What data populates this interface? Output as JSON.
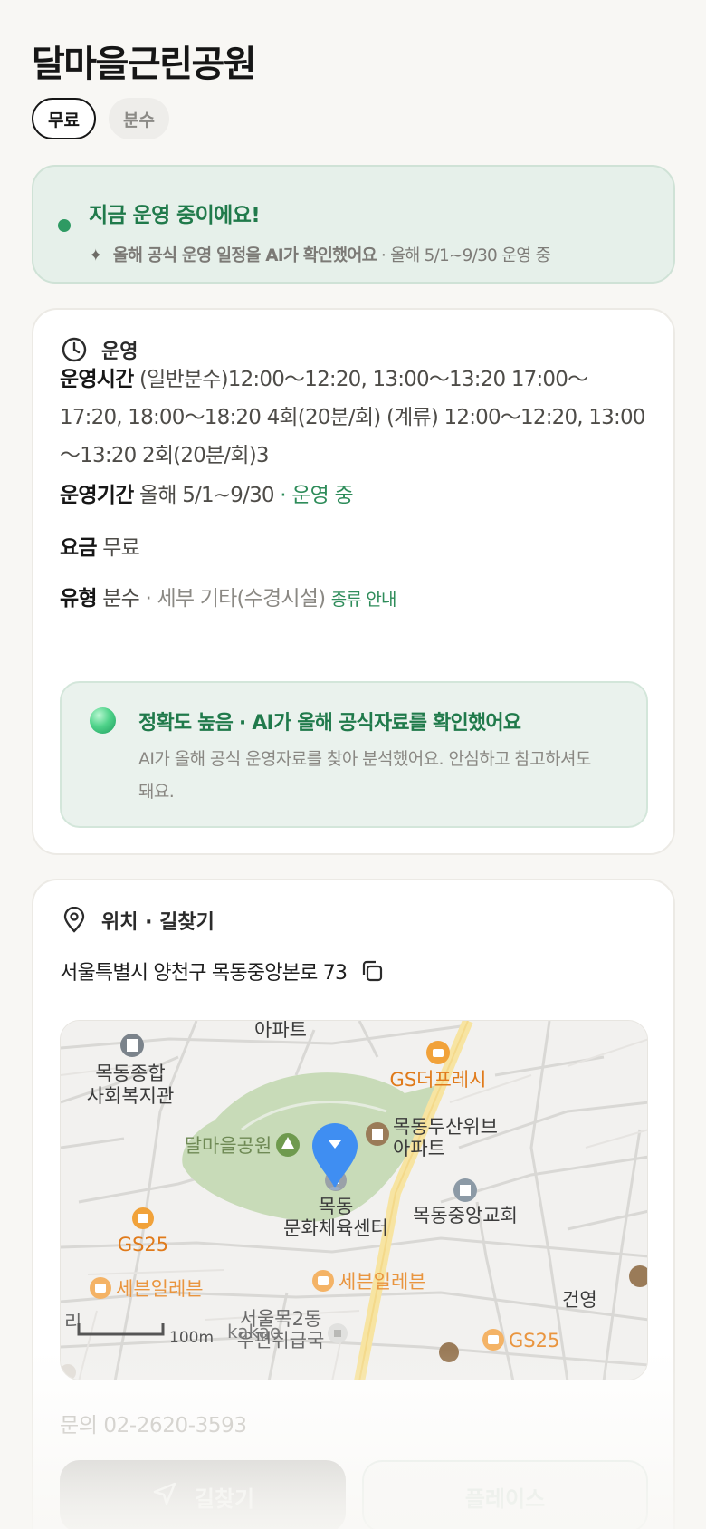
{
  "header": {
    "title": "달마을근린공원"
  },
  "chips": [
    {
      "label": "무료",
      "active": true
    },
    {
      "label": "분수",
      "active": false
    }
  ],
  "status": {
    "headline": "지금 운영 중이에요!",
    "ai_note": "올해 공식 운영 일정을 AI가 확인했어요",
    "period": "· 올해 5/1~9/30 운영 중",
    "accent_color": "#2e9a63"
  },
  "operation": {
    "section_title": "운영",
    "hours_label": "운영시간",
    "hours_value": "(일반분수)12:00～12:20, 13:00～13:20 17:00～17:20, 18:00～18:20 4회(20분/회) (계류) 12:00～12:20, 13:00～13:20 2회(20분/회)3",
    "period_label": "운영기간",
    "period_value": "올해 5/1~9/30",
    "period_status": "· 운영 중",
    "fee_label": "요금",
    "fee_value": "무료",
    "type_label": "유형",
    "type_value": "분수",
    "type_detail": "· 세부 기타(수경시설)",
    "type_link": "종류 안내",
    "accuracy_title": "정확도 높음 · AI가 올해 공식자료를 확인했어요",
    "accuracy_desc": "AI가 올해 공식 운영자료를 찾아 분석했어요. 안심하고 참고하셔도 돼요."
  },
  "location": {
    "section_title": "위치 · 길찾기",
    "address": "서울특별시 양천구 목동중앙본로 73",
    "map": {
      "labels": {
        "apt_top": "아파트",
        "welfare1": "목동종합",
        "welfare2": "사회복지관",
        "gs_fresh": "GS더프레시",
        "park": "달마을공원",
        "doosan1": "목동두산위브",
        "doosan2": "아파트",
        "center1": "목동",
        "center2": "문화체육센터",
        "church": "목동중앙교회",
        "gs25_left": "GS25",
        "seven_left": "세븐일레븐",
        "seven_mid": "세븐일레븐",
        "building": "건영",
        "post1": "서울목2동",
        "post2": "우편취급국",
        "gs25_right": "GS25",
        "ri": "리",
        "scale": "100m",
        "brand": "kakao"
      }
    },
    "contact": "문의 02-2620-3593",
    "directions_button": "길찾기",
    "place_button": "플레이스"
  }
}
